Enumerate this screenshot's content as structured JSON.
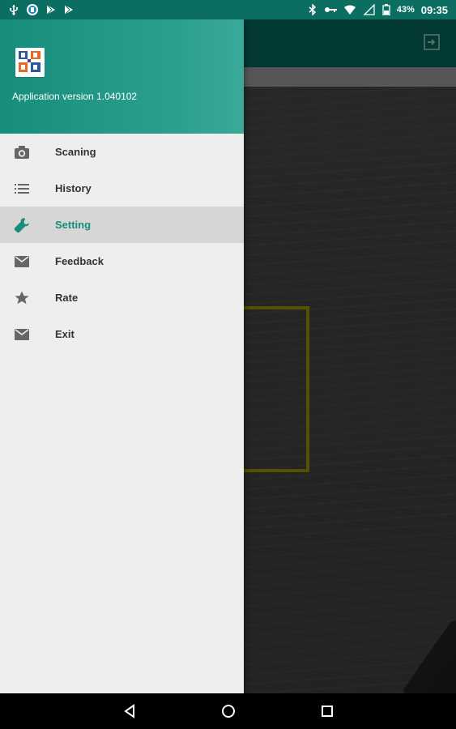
{
  "status_bar": {
    "battery_percent": "43%",
    "time": "09:35",
    "left_icons": [
      "usb-icon",
      "app-notification-icon",
      "play-store-icon",
      "play-store-icon"
    ],
    "right_icons": [
      "bluetooth-icon",
      "key-icon",
      "wifi-icon",
      "signal-off-icon",
      "battery-icon"
    ]
  },
  "drawer": {
    "app_version": "Application version 1.040102",
    "menu": [
      {
        "label": "Scaning",
        "icon": "camera-icon",
        "active": false
      },
      {
        "label": "History",
        "icon": "list-icon",
        "active": false
      },
      {
        "label": "Setting",
        "icon": "wrench-icon",
        "active": true
      },
      {
        "label": "Feedback",
        "icon": "mail-icon",
        "active": false
      },
      {
        "label": "Rate",
        "icon": "star-icon",
        "active": false
      },
      {
        "label": "Exit",
        "icon": "mail-icon",
        "active": false
      }
    ]
  },
  "toolbar": {
    "action_icon": "logout-icon"
  },
  "camera": {
    "scan_frame_color": "#8a8400"
  },
  "nav_bar": {
    "buttons": [
      "back-icon",
      "home-icon",
      "recents-icon"
    ]
  },
  "colors": {
    "status_bar": "#0b6e60",
    "toolbar": "#065d53",
    "accent": "#178d7b",
    "drawer_background": "#eeeeee"
  }
}
